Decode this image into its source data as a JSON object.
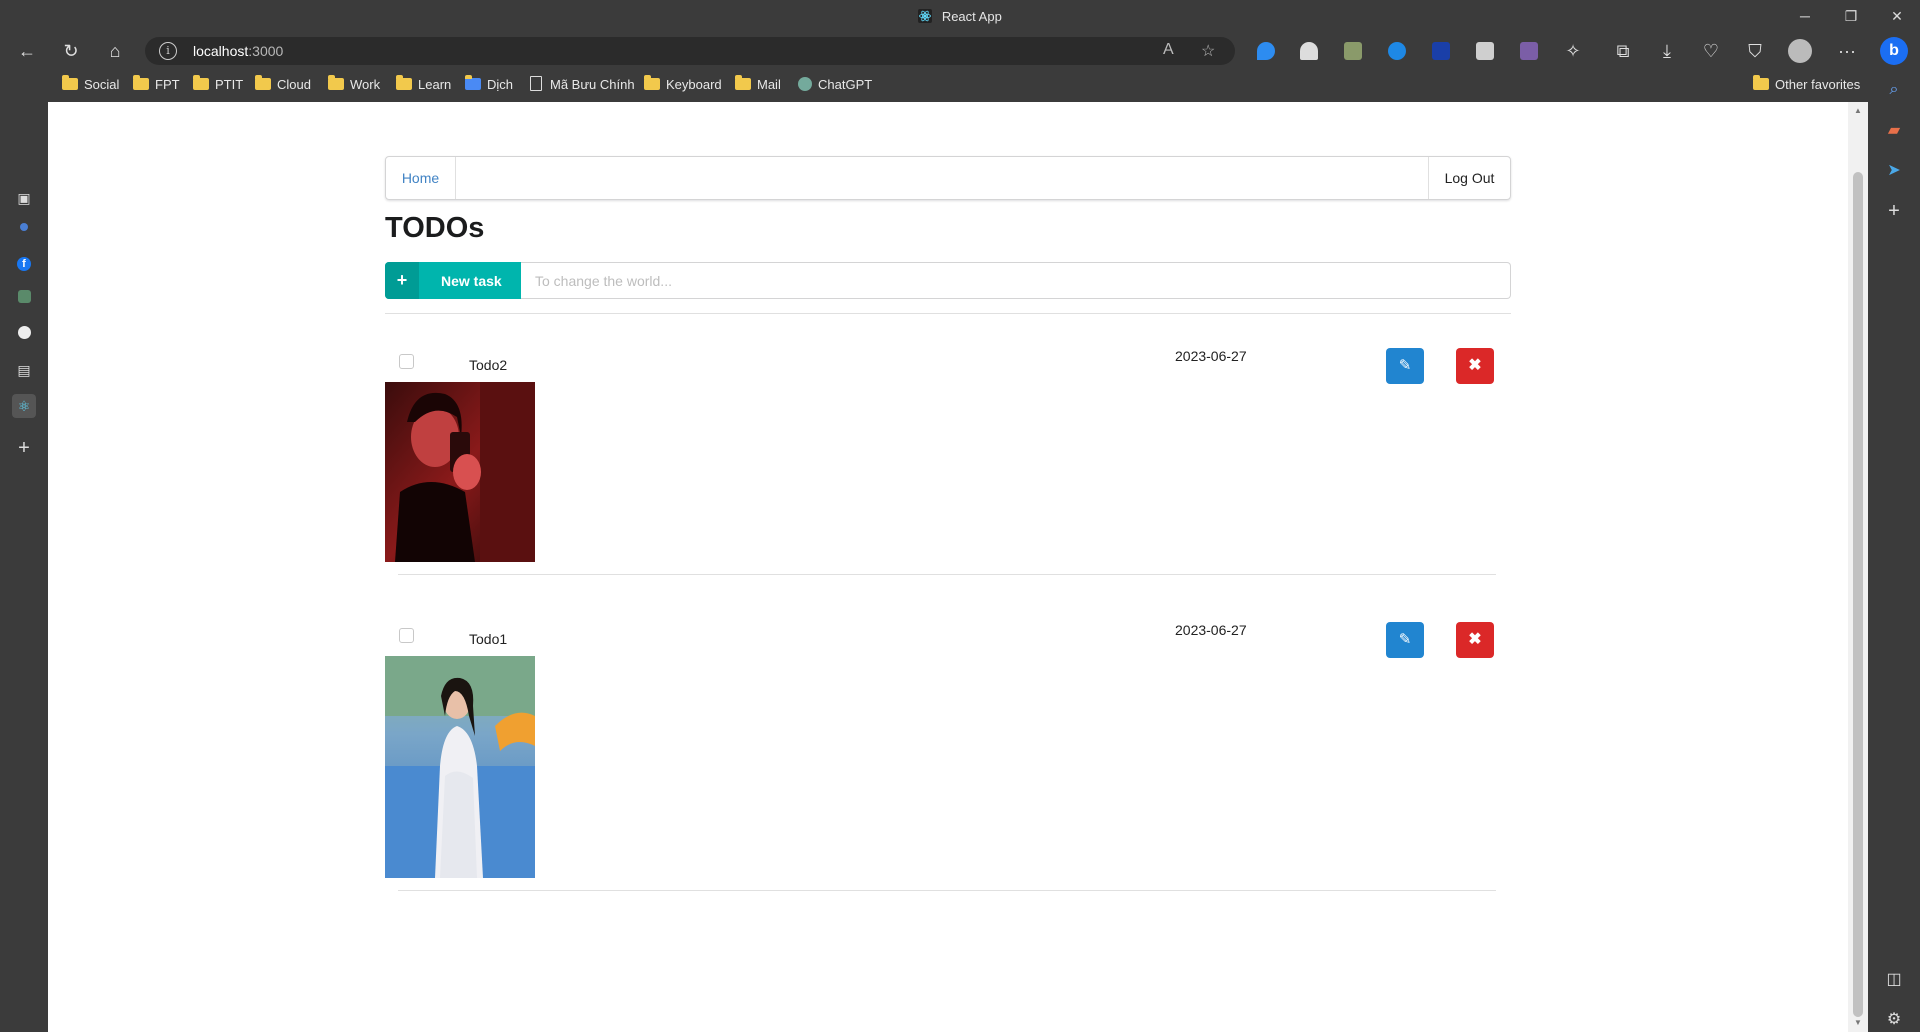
{
  "window": {
    "title": "React App",
    "minimize": "─",
    "restore": "❐",
    "close": "✕"
  },
  "toolbar": {
    "url_host": "localhost",
    "url_port": ":3000",
    "read_aloud": "A",
    "favorite": "☆",
    "more": "···"
  },
  "bookmarks": [
    {
      "label": "Social"
    },
    {
      "label": "FPT"
    },
    {
      "label": "PTIT"
    },
    {
      "label": "Cloud"
    },
    {
      "label": "Work"
    },
    {
      "label": "Learn"
    },
    {
      "label": "Dịch"
    },
    {
      "label": "Mã Bưu Chính"
    },
    {
      "label": "Keyboard"
    },
    {
      "label": "Mail"
    },
    {
      "label": "ChatGPT"
    }
  ],
  "other_favorites": "Other favorites",
  "app": {
    "nav": {
      "home": "Home",
      "logout": "Log Out"
    },
    "heading": "TODOs",
    "new_task": {
      "label": "New task",
      "icon": "+"
    },
    "task_input": {
      "placeholder": "To change the world...",
      "value": ""
    },
    "todos": [
      {
        "name": "Todo2",
        "date": "2023-06-27",
        "completed": false,
        "photo": "red-selfie"
      },
      {
        "name": "Todo1",
        "date": "2023-06-27",
        "completed": false,
        "photo": "pool-portrait"
      }
    ],
    "edit_icon": "✎",
    "delete_icon": "✖"
  },
  "colors": {
    "accent_teal": "#00b5ad",
    "edit_blue": "#2185d0",
    "delete_red": "#db2828",
    "link_blue": "#4183c4"
  }
}
